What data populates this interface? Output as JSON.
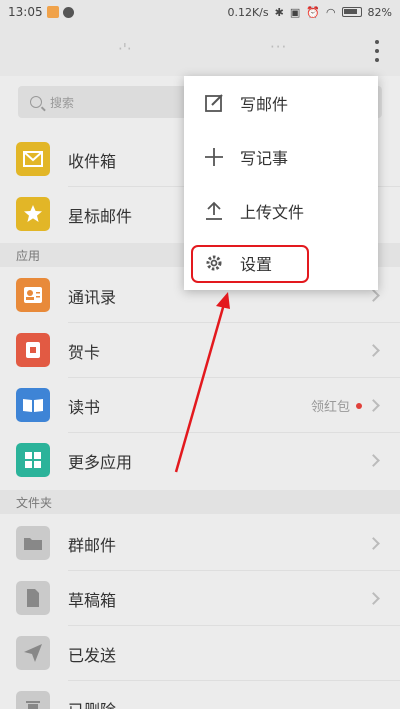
{
  "status_bar": {
    "time": "13:05",
    "speed": "0.12K/s",
    "battery": "82%"
  },
  "header": {
    "title_left": "·'· ",
    "title_right": "···"
  },
  "search": {
    "placeholder": "搜索"
  },
  "rows_top": [
    {
      "label": "收件箱",
      "icon": "inbox-icon",
      "color": "#e2b627"
    },
    {
      "label": "星标邮件",
      "icon": "star-icon",
      "color": "#e2b627"
    }
  ],
  "section_apps": "应用",
  "rows_apps": [
    {
      "label": "通讯录",
      "icon": "contacts-icon"
    },
    {
      "label": "贺卡",
      "icon": "card-icon"
    },
    {
      "label": "读书",
      "icon": "book-icon",
      "badge": "领红包"
    },
    {
      "label": "更多应用",
      "icon": "grid-icon"
    }
  ],
  "section_folders": "文件夹",
  "rows_folders": [
    {
      "label": "群邮件",
      "icon": "folder-icon"
    },
    {
      "label": "草稿箱",
      "icon": "draft-icon"
    },
    {
      "label": "已发送",
      "icon": "send-icon"
    },
    {
      "label": "已删除",
      "icon": "trash-icon"
    }
  ],
  "menu": {
    "items": [
      {
        "label": "写邮件",
        "icon": "compose-icon"
      },
      {
        "label": "写记事",
        "icon": "plus-icon"
      },
      {
        "label": "上传文件",
        "icon": "upload-icon"
      },
      {
        "label": "设置",
        "icon": "gear-icon"
      }
    ]
  },
  "colors": {
    "highlight": "#e3191e",
    "accent_yellow": "#e2b627"
  }
}
